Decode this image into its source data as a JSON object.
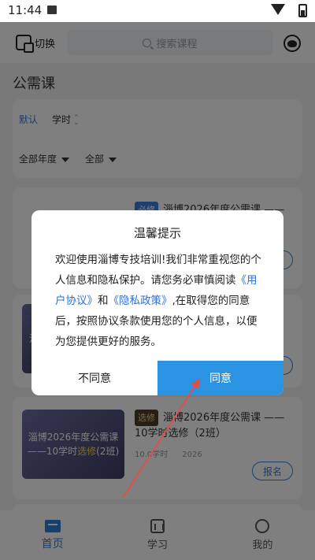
{
  "status": {
    "time": "11:44"
  },
  "topbar": {
    "switch_label": "切换",
    "search_placeholder": "搜索课程"
  },
  "page_title": "公需课",
  "filters": {
    "sort_default": "默认",
    "sort_hours": "学时",
    "year": "全部年度",
    "all": "全部"
  },
  "courses": [
    {
      "tag": "必修",
      "title": "淄博2026年度公需课 ——20",
      "signup": "报名"
    },
    {
      "thumb_line1": "淄",
      "signup": "报名"
    },
    {
      "tag": "选修",
      "title": "淄博2026年度公需课 ——10学时选修（2班）",
      "thumb_line1": "淄博2026年度公需课",
      "thumb_line2_a": "——10学时",
      "thumb_line2_b": "选修",
      "thumb_line2_c": "(2班)",
      "hours": "10.0学时",
      "year": "2026",
      "signup": "报名"
    }
  ],
  "tabbar": {
    "home": "首页",
    "study": "学习",
    "me": "我的"
  },
  "dialog": {
    "title": "温馨提示",
    "body_1": "欢迎使用淄博专技培训!我们非常重视您的个人信息和隐私保护。请您务必审慎阅读",
    "link_user": "《用户协议》",
    "body_and": "和",
    "link_privacy": "《隐私政策》",
    "body_2": ",在取得您的同意后，按照协议条款使用您的个人信息，以便为您提供更好的服务。",
    "disagree": "不同意",
    "agree": "同意"
  },
  "colors": {
    "accent": "#2a93e2",
    "link": "#2f6fd8",
    "arrow": "#e0504a"
  }
}
